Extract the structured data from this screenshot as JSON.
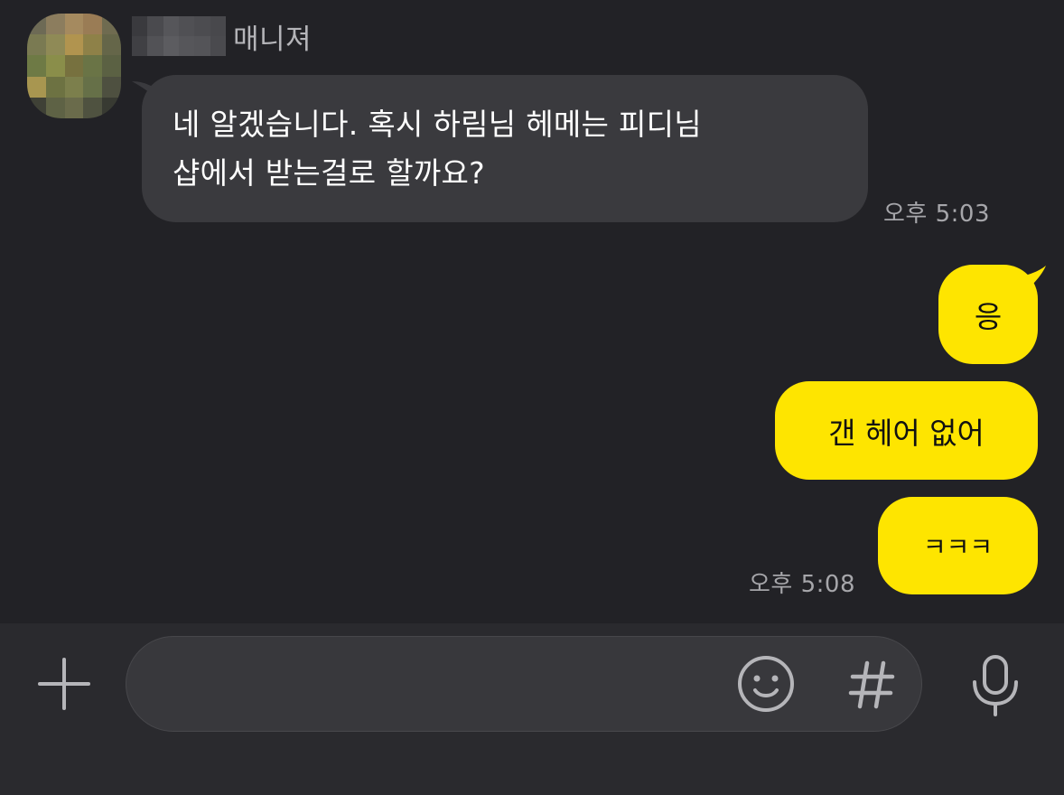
{
  "conversation": {
    "incoming": {
      "sender_suffix": "매니져",
      "lines": [
        "네 알겠습니다. 혹시 하림님 헤메는 피디님",
        "샵에서 받는걸로 할까요?"
      ],
      "time": "오후 5:03"
    },
    "outgoing": {
      "messages": [
        "응",
        "갠 헤어 없어",
        "ㅋㅋㅋ"
      ],
      "time": "오후 5:08"
    }
  },
  "composer": {
    "value": "",
    "placeholder": ""
  },
  "icons": {
    "plus": "plus-icon",
    "emoji": "emoji-icon",
    "hashtag": "hashtag-icon",
    "microphone": "microphone-icon"
  },
  "colors": {
    "background": "#222226",
    "incoming_bubble": "#3a3a3e",
    "outgoing_bubble": "#fee500",
    "timestamp": "#a6a6aa",
    "input_bar": "#2a2a2e"
  }
}
